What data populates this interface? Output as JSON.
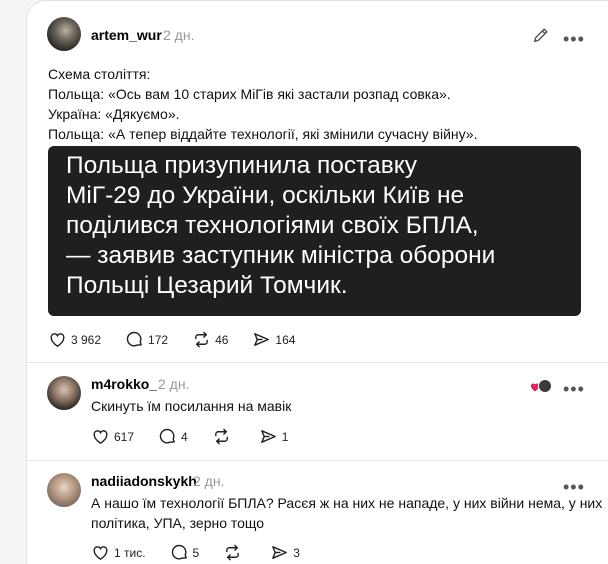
{
  "posts": [
    {
      "username": "artem_wur",
      "time": "2 дн.",
      "lines": [
        "Схема століття:",
        "Польща: «Ось вам 10 старих МіГів які застали розпад совка».",
        "Україна: «Дякуємо».",
        "Польща: «А тепер віддайте технології, які змінили сучасну війну»."
      ],
      "banner_lines": [
        "Польща призупинила поставку",
        "МіГ-29 до України, оскільки Київ не",
        "поділився технологіями своїх БПЛА,",
        "— заявив заступник міністра оборони",
        "Польщі Цезарий Томчик."
      ],
      "likes": "3 962",
      "comments": "172",
      "reposts": "46",
      "shares": "164"
    },
    {
      "username": "m4rokko_",
      "time": "2 дн.",
      "text": "Скинуть їм посилання на мавік",
      "likes": "617",
      "comments": "4",
      "reposts": "",
      "shares": "1"
    },
    {
      "username": "nadiiadonskykh",
      "time": "2 дн.",
      "lines": [
        "А нашо їм технології БПЛА? Расєя ж на них не нападе, у них війни нема, у них",
        "політика, УПА, зерно тощо"
      ],
      "likes": "1 тис.",
      "comments": "5",
      "reposts": "",
      "shares": "3"
    }
  ],
  "icons": {
    "edit": "pencil-icon",
    "more": "more-icon",
    "like": "heart-icon",
    "comment": "comment-icon",
    "repost": "repost-icon",
    "share": "share-icon"
  },
  "colors": {
    "banner_bg": "#1f1f1f",
    "react_heart": "#e0245e"
  },
  "more_glyph": "•••"
}
